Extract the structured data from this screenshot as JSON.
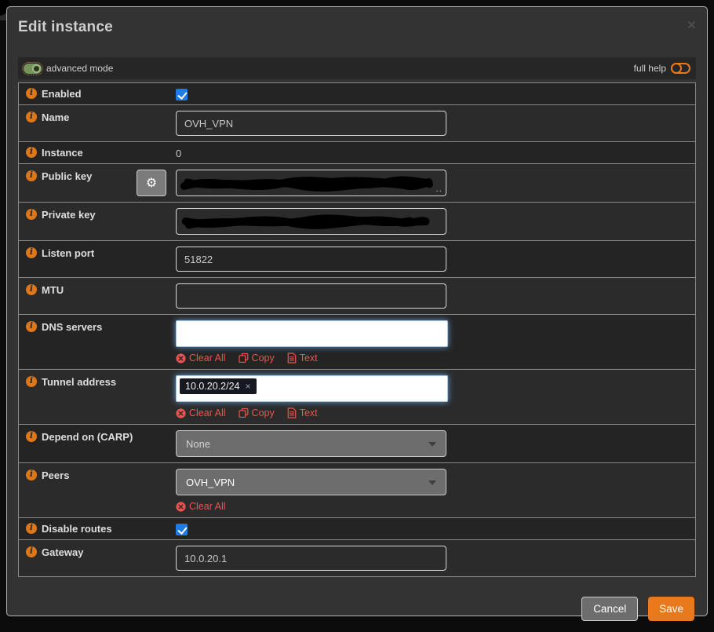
{
  "window": {
    "title": "Edit instance",
    "close_glyph": "×"
  },
  "help_bar": {
    "advanced_mode_label": "advanced mode",
    "full_help_label": "full help"
  },
  "fields": {
    "enabled": {
      "label": "Enabled",
      "checked": true
    },
    "name": {
      "label": "Name",
      "value": "OVH_VPN"
    },
    "instance": {
      "label": "Instance",
      "value": "0"
    },
    "public_key": {
      "label": "Public key",
      "redacted": true,
      "overflow_hint": ".."
    },
    "private_key": {
      "label": "Private key",
      "redacted": true
    },
    "listen_port": {
      "label": "Listen port",
      "value": "51822"
    },
    "mtu": {
      "label": "MTU",
      "value": ""
    },
    "dns_servers": {
      "label": "DNS servers",
      "value": "",
      "actions": {
        "clear": "Clear All",
        "copy": "Copy",
        "text": "Text"
      }
    },
    "tunnel_address": {
      "label": "Tunnel address",
      "token": "10.0.20.2/24",
      "token_remove": "×",
      "actions": {
        "clear": "Clear All",
        "copy": "Copy",
        "text": "Text"
      }
    },
    "depend_on_carp": {
      "label": "Depend on (CARP)",
      "selected": "None"
    },
    "peers": {
      "label": "Peers",
      "selected": "OVH_VPN",
      "actions": {
        "clear": "Clear All"
      }
    },
    "disable_routes": {
      "label": "Disable routes",
      "checked": true
    },
    "gateway": {
      "label": "Gateway",
      "value": "10.0.20.1"
    }
  },
  "icons": {
    "gear": "⚙"
  },
  "footer": {
    "cancel_label": "Cancel",
    "save_label": "Save"
  },
  "colors": {
    "accent_orange": "#e8791d",
    "link_red": "#ea5450",
    "checkbox_blue": "#1d7ce5",
    "toggle_green": "#76955a",
    "modal_bg": "#333333",
    "row_dark": "#242424",
    "row_light": "#2b2b2b"
  }
}
